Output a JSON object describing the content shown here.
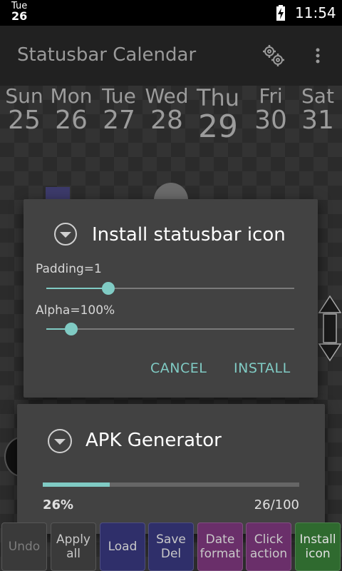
{
  "status_bar": {
    "dow": "Tue",
    "day": "26",
    "time": "11:54",
    "battery_icon": "battery-charging-icon"
  },
  "action_bar": {
    "title": "Statusbar Calendar",
    "settings_icon": "gear-icon",
    "menu_icon": "more-vert-icon"
  },
  "week": [
    {
      "name": "Sun",
      "date": "25"
    },
    {
      "name": "Mon",
      "date": "26"
    },
    {
      "name": "Tue",
      "date": "27"
    },
    {
      "name": "Wed",
      "date": "28"
    },
    {
      "name": "Thu",
      "date": "29"
    },
    {
      "name": "Fri",
      "date": "30"
    },
    {
      "name": "Sat",
      "date": "31"
    }
  ],
  "install_dialog": {
    "title": "Install statusbar icon",
    "padding_label": "Padding=1",
    "padding_value": 0.25,
    "alpha_label": "Alpha=100%",
    "alpha_value": 0.1,
    "cancel_label": "CANCEL",
    "install_label": "INSTALL"
  },
  "apk_dialog": {
    "title": "APK Generator",
    "progress": 0.26,
    "percent_text": "26%",
    "count_text": "26/100"
  },
  "bottom_buttons": [
    {
      "label": "Undo",
      "bg": "#3a3a3a",
      "color": "#7d7d7d"
    },
    {
      "label": "Apply all",
      "bg": "#3a3a3a",
      "color": "#c8c8c8"
    },
    {
      "label": "Load",
      "bg": "#2f2f6a",
      "color": "#c8c8c8"
    },
    {
      "label": "Save Del",
      "bg": "#2f2f6a",
      "color": "#c8c8c8"
    },
    {
      "label": "Date format",
      "bg": "#6a2f6a",
      "color": "#c8c8c8"
    },
    {
      "label": "Click action",
      "bg": "#6a2f6a",
      "color": "#c8c8c8"
    },
    {
      "label": "Install icon",
      "bg": "#2f6a2f",
      "color": "#e0e0e0"
    }
  ],
  "colors": {
    "accent": "#80cbc4",
    "dialog_bg": "#424242"
  }
}
